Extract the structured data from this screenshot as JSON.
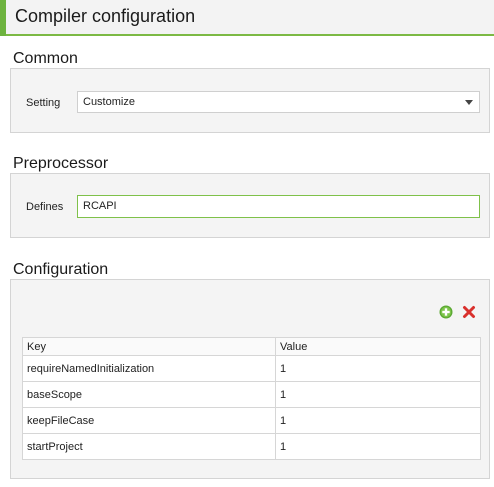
{
  "header": {
    "title": "Compiler configuration"
  },
  "common": {
    "section_title": "Common",
    "setting_label": "Setting",
    "setting_value": "Customize"
  },
  "preprocessor": {
    "section_title": "Preprocessor",
    "defines_label": "Defines",
    "defines_value": "RCAPI"
  },
  "configuration": {
    "section_title": "Configuration",
    "add_icon": "plus-circle-icon",
    "remove_icon": "x-icon",
    "columns": [
      "Key",
      "Value"
    ],
    "rows": [
      {
        "key": "requireNamedInitialization",
        "value": "1"
      },
      {
        "key": "baseScope",
        "value": "1"
      },
      {
        "key": "keepFileCase",
        "value": "1"
      },
      {
        "key": "startProject",
        "value": "1"
      }
    ]
  },
  "colors": {
    "accent_green": "#6db33f",
    "remove_red": "#d9302c",
    "panel_bg": "#f4f4f4"
  }
}
